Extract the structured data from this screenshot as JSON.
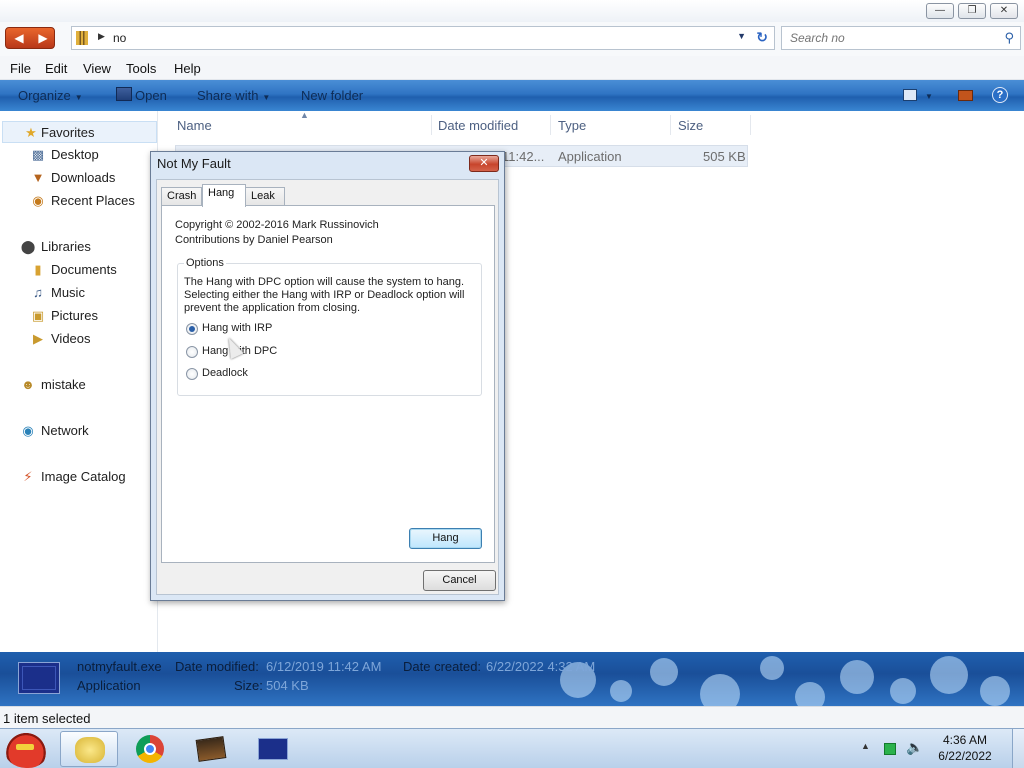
{
  "window": {
    "minimize_icon": "minimize-icon",
    "maximize_icon": "restore-icon",
    "close_icon": "close-icon"
  },
  "address": {
    "path": "no",
    "search_placeholder": "Search no"
  },
  "menu": [
    "File",
    "Edit",
    "View",
    "Tools",
    "Help"
  ],
  "commands": {
    "organize": "Organize",
    "open": "Open",
    "share_with": "Share with",
    "new_folder": "New folder"
  },
  "sidebar": {
    "favorites": "Favorites",
    "desktop": "Desktop",
    "downloads": "Downloads",
    "recent_places": "Recent Places",
    "libraries": "Libraries",
    "documents": "Documents",
    "music": "Music",
    "pictures": "Pictures",
    "videos": "Videos",
    "mistake": "mistake",
    "network": "Network",
    "image_catalog": "Image Catalog"
  },
  "columns": {
    "name": "Name",
    "date_modified": "Date modified",
    "type": "Type",
    "size": "Size"
  },
  "file": {
    "date_fragment": "11:42...",
    "type": "Application",
    "size": "505 KB"
  },
  "dialog": {
    "title": "Not My Fault",
    "close_glyph": "✕",
    "tabs": [
      "Crash",
      "Hang",
      "Leak"
    ],
    "copyright": "Copyright © 2002-2016 Mark Russinovich",
    "contributions": "Contributions by Daniel Pearson",
    "options_label": "Options",
    "description": "The Hang with DPC option will cause the system to hang. Selecting either the Hang with IRP or Deadlock option will prevent the application from closing.",
    "radios": [
      "Hang with IRP",
      "Hang with DPC",
      "Deadlock"
    ],
    "selected_radio": "Hang with IRP",
    "hang_button": "Hang",
    "cancel_button": "Cancel"
  },
  "details": {
    "filename": "notmyfault.exe",
    "date_modified_label": "Date modified:",
    "date_modified_value": "6/12/2019 11:42 AM",
    "date_created_label": "Date created:",
    "date_created_value": "6/22/2022 4:32 AM",
    "type": "Application",
    "size_label": "Size:",
    "size_value": "504 KB"
  },
  "status": {
    "selection": "1 item selected"
  },
  "taskbar": {
    "time": "4:36 AM",
    "date": "6/22/2022"
  }
}
